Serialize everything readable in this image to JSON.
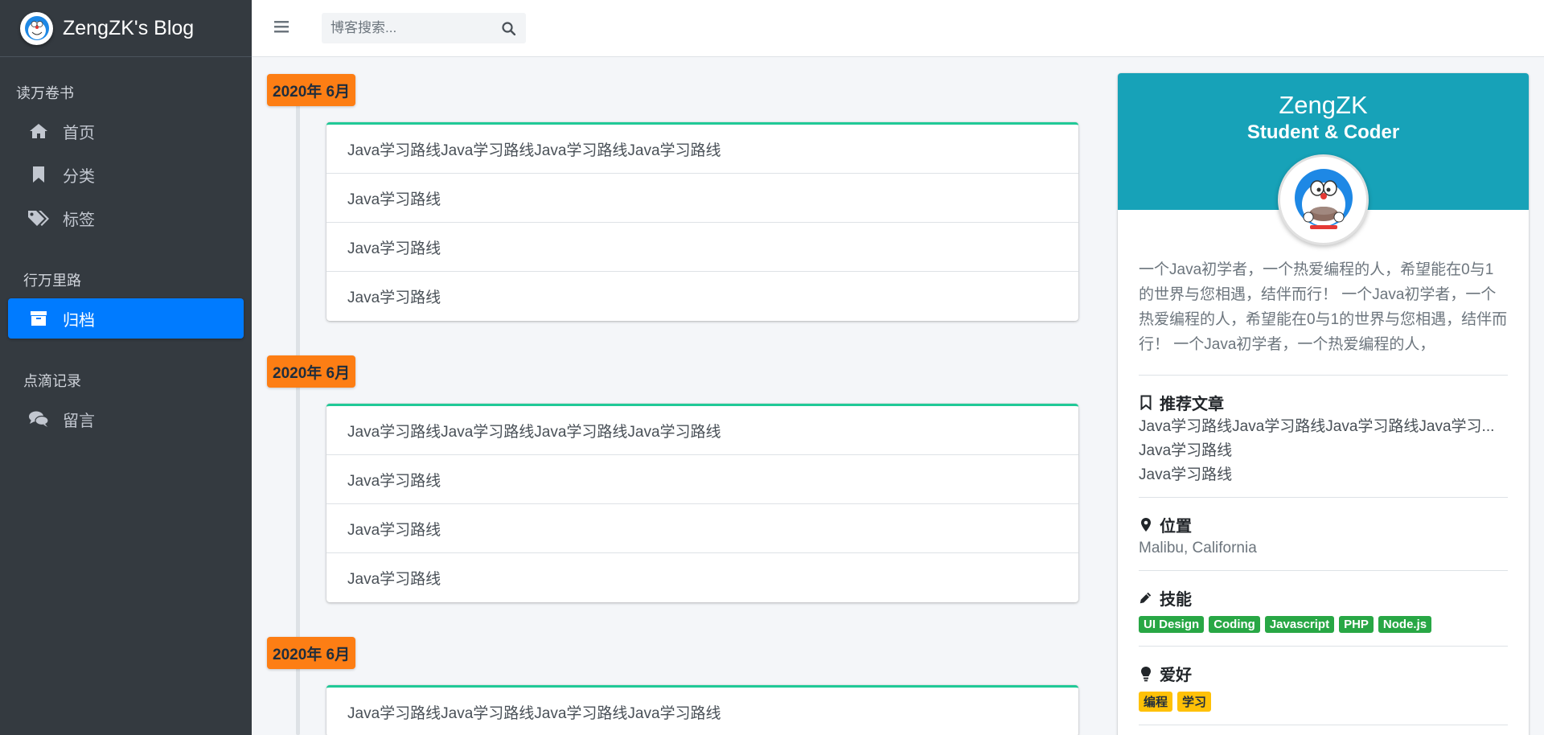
{
  "brand": {
    "title": "ZengZK's Blog"
  },
  "sidebar": {
    "sections": [
      {
        "header": "读万卷书",
        "items": [
          {
            "label": "首页",
            "icon": "home-icon"
          },
          {
            "label": "分类",
            "icon": "bookmark-icon"
          },
          {
            "label": "标签",
            "icon": "tags-icon"
          }
        ]
      },
      {
        "header": "行万里路",
        "items": [
          {
            "label": "归档",
            "icon": "archive-icon",
            "active": true
          }
        ]
      },
      {
        "header": "点滴记录",
        "items": [
          {
            "label": "留言",
            "icon": "comments-icon"
          }
        ]
      }
    ]
  },
  "search": {
    "placeholder": "博客搜索..."
  },
  "timeline": [
    {
      "label": "2020年 6月",
      "posts": [
        "Java学习路线Java学习路线Java学习路线Java学习路线",
        "Java学习路线",
        "Java学习路线",
        "Java学习路线"
      ]
    },
    {
      "label": "2020年 6月",
      "posts": [
        "Java学习路线Java学习路线Java学习路线Java学习路线",
        "Java学习路线",
        "Java学习路线",
        "Java学习路线"
      ]
    },
    {
      "label": "2020年 6月",
      "posts": [
        "Java学习路线Java学习路线Java学习路线Java学习路线"
      ]
    }
  ],
  "profile": {
    "name": "ZengZK",
    "role": "Student & Coder",
    "bio": "一个Java初学者，一个热爱编程的人，希望能在0与1的世界与您相遇，结伴而行！ 一个Java初学者，一个热爱编程的人，希望能在0与1的世界与您相遇，结伴而行！ 一个Java初学者，一个热爱编程的人，",
    "recommended_title": "推荐文章",
    "recommended": [
      "Java学习路线Java学习路线Java学习路线Java学习...",
      "Java学习路线",
      "Java学习路线"
    ],
    "location_title": "位置",
    "location": "Malibu, California",
    "skills_title": "技能",
    "skills": [
      "UI Design",
      "Coding",
      "Javascript",
      "PHP",
      "Node.js"
    ],
    "hobbies_title": "爱好",
    "hobbies": [
      "编程",
      "学习"
    ]
  },
  "colors": {
    "sidebar_bg": "#343a40",
    "active": "#007bff",
    "timeline_label": "#fd7e14",
    "card_top": "#20c997",
    "profile_head": "#17a2b8",
    "skill_badge": "#28a745",
    "hobby_badge": "#ffc107"
  }
}
